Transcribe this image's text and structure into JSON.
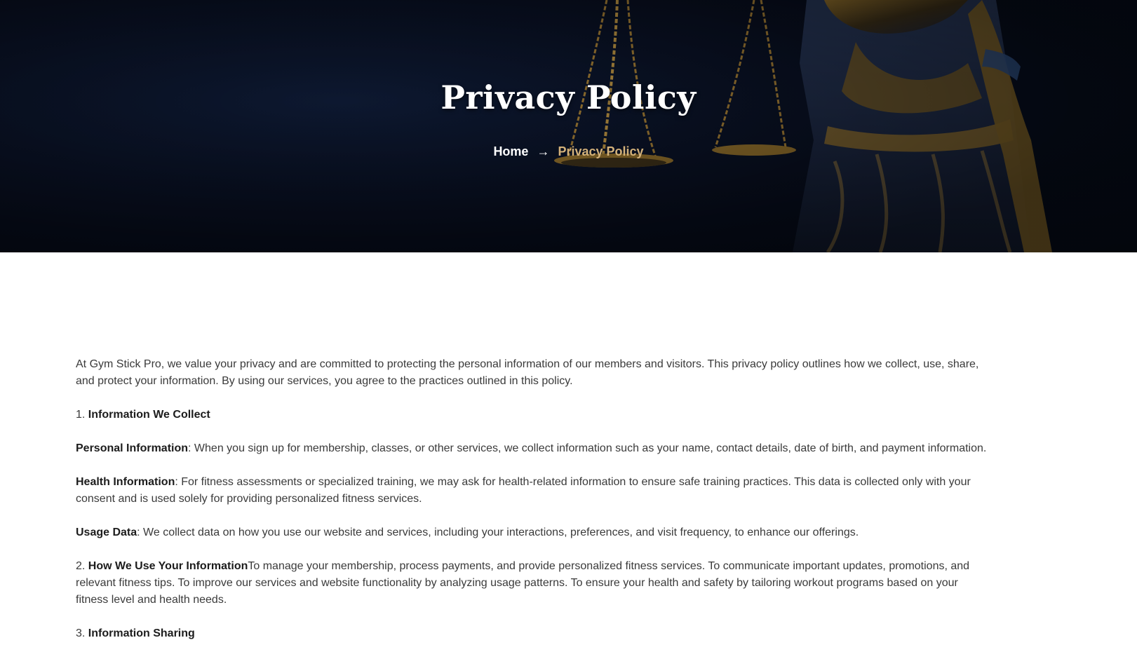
{
  "hero": {
    "title": "Privacy Policy",
    "breadcrumb": {
      "home": "Home",
      "current": "Privacy Policy"
    }
  },
  "colors": {
    "accent": "#d4b27a",
    "hero_bg": "#070d1d",
    "text": "#3a3a3a"
  },
  "content": {
    "intro": "At Gym Stick Pro, we value your privacy and are committed to protecting the personal information of our members and visitors. This privacy policy outlines how we collect, use, share, and protect your information. By using our services, you agree to the practices outlined in this policy.",
    "section1": {
      "num": "1. ",
      "heading": "Information We Collect"
    },
    "personal": {
      "label": "Personal Information",
      "text": ": When you sign up for membership, classes, or other services, we collect information such as your name, contact details, date of birth, and payment information."
    },
    "health": {
      "label": "Health Information",
      "text": ": For fitness assessments or specialized training, we may ask for health-related information to ensure safe training practices. This data is collected only with your consent and is used solely for providing personalized fitness services."
    },
    "usage": {
      "label": "Usage Data",
      "text": ": We collect data on how you use our website and services, including your interactions, preferences, and visit frequency, to enhance our offerings."
    },
    "section2": {
      "num": "2. ",
      "heading": "How We Use Your Information",
      "text": "To manage your membership, process payments, and provide personalized fitness services. To communicate important updates, promotions, and relevant fitness tips. To improve our services and website functionality by analyzing usage patterns. To ensure your health and safety by tailoring workout programs based on your fitness level and health needs."
    },
    "section3": {
      "num": "3. ",
      "heading": "Information Sharing"
    }
  }
}
